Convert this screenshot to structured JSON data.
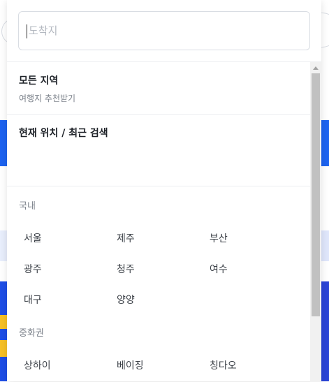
{
  "search": {
    "placeholder": "도착지",
    "value": ""
  },
  "dropdown": {
    "all_regions": {
      "title": "모든 지역",
      "subtitle": "여행지 추천받기"
    },
    "current_location": {
      "title": "현재 위치 / 최근 검색"
    },
    "sections": [
      {
        "title": "국내",
        "cities": [
          "서울",
          "제주",
          "부산",
          "광주",
          "청주",
          "여수",
          "대구",
          "양양"
        ]
      },
      {
        "title": "중화권",
        "cities": [
          "상하이",
          "베이징",
          "칭다오"
        ]
      }
    ]
  },
  "colors": {
    "brand_blue": "#1d63f0",
    "banner_yellow": "#f6c026",
    "text_primary": "#1d2127",
    "text_secondary": "#7c828b"
  }
}
